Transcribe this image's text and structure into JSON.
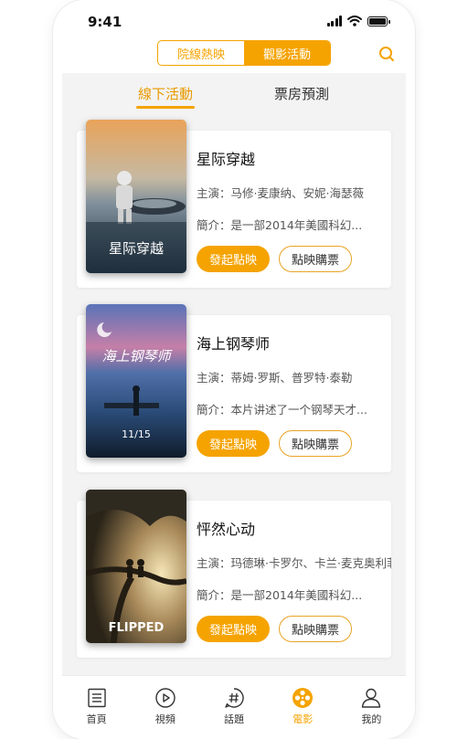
{
  "status": {
    "time": "9:41"
  },
  "header": {
    "segments": [
      {
        "label": "院線熱映",
        "active": false
      },
      {
        "label": "觀影活動",
        "active": true
      }
    ]
  },
  "subtabs": [
    {
      "label": "線下活動",
      "active": true
    },
    {
      "label": "票房預測",
      "active": false
    }
  ],
  "movies": [
    {
      "title": "星际穿越",
      "cast": "主演：马修·麦康纳、安妮·海瑟薇",
      "synopsis": "簡介：是一部2014年美國科幻...",
      "poster_text": "星际穿越"
    },
    {
      "title": "海上钢琴师",
      "cast": "主演：蒂姆·罗斯、普罗特·泰勒",
      "synopsis": "簡介：本片讲述了一个钢琴天才...",
      "poster_text": "海上钢琴师",
      "poster_date": "11/15"
    },
    {
      "title": "怦然心动",
      "cast": "主演：玛德琳·卡罗尔、卡兰·麦克奥利菲",
      "synopsis": "簡介：是一部2014年美國科幻...",
      "poster_text": "FLIPPED"
    }
  ],
  "buttons": {
    "primary": "發起點映",
    "secondary": "點映購票"
  },
  "tabbar": [
    {
      "label": "首頁",
      "icon": "home-icon",
      "active": false
    },
    {
      "label": "視頻",
      "icon": "play-icon",
      "active": false
    },
    {
      "label": "話題",
      "icon": "hashtag-icon",
      "active": false
    },
    {
      "label": "電影",
      "icon": "film-reel-icon",
      "active": true
    },
    {
      "label": "我的",
      "icon": "user-icon",
      "active": false
    }
  ],
  "colors": {
    "accent": "#f5a300",
    "background": "#f3f3f3"
  }
}
